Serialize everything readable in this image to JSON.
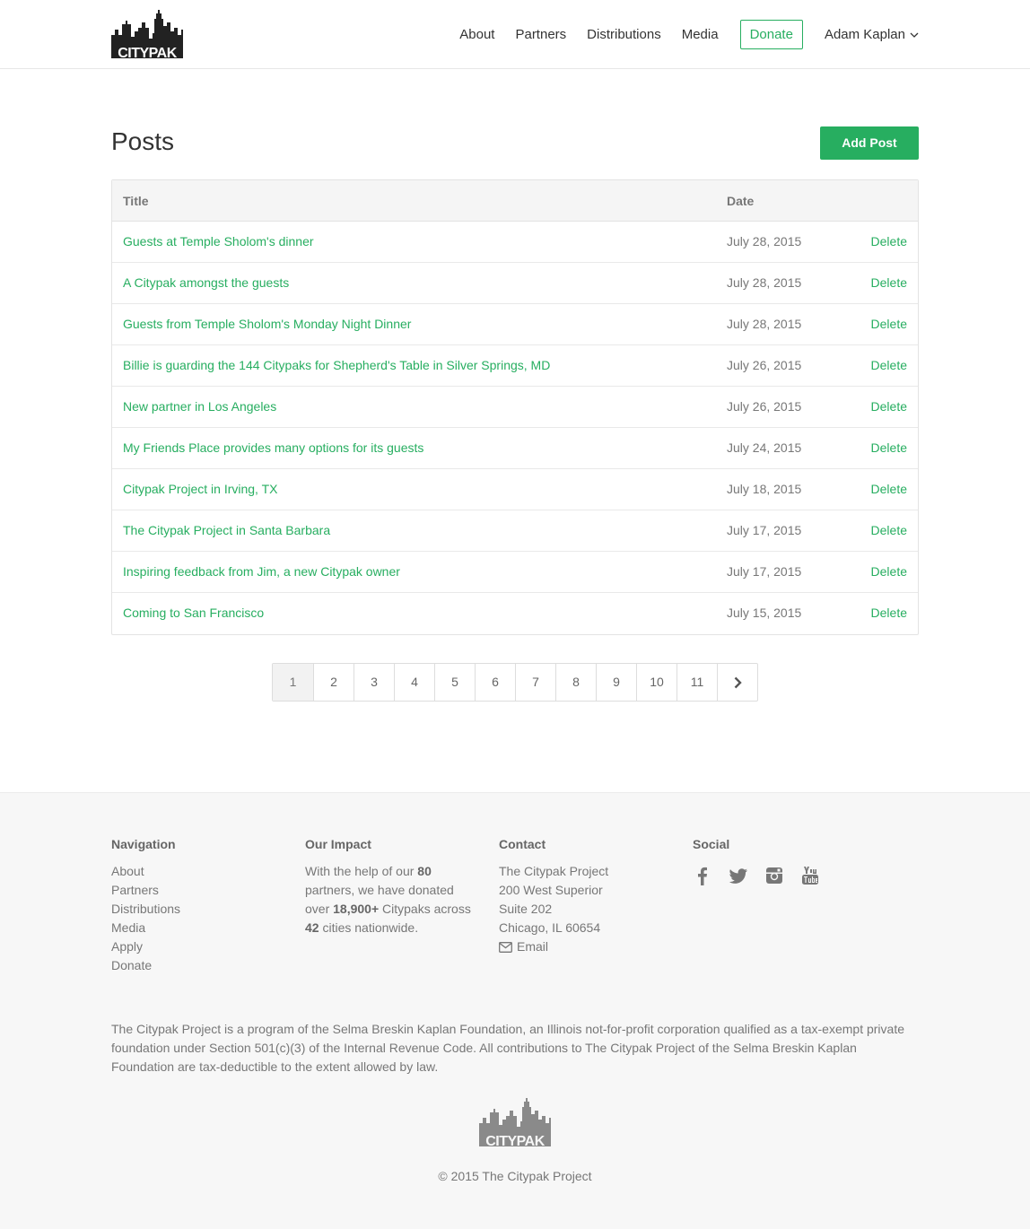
{
  "header": {
    "brand": "CITYPAK",
    "nav": [
      "About",
      "Partners",
      "Distributions",
      "Media"
    ],
    "donate_label": "Donate",
    "user_name": "Adam Kaplan"
  },
  "main": {
    "title": "Posts",
    "add_post_label": "Add Post",
    "table": {
      "col_title": "Title",
      "col_date": "Date",
      "delete_label": "Delete",
      "rows": [
        {
          "title": "Guests at Temple Sholom's dinner",
          "date": "July 28, 2015"
        },
        {
          "title": "A Citypak amongst the guests",
          "date": "July 28, 2015"
        },
        {
          "title": "Guests from Temple Sholom's Monday Night Dinner",
          "date": "July 28, 2015"
        },
        {
          "title": "Billie is guarding the 144 Citypaks for Shepherd's Table in Silver Springs, MD",
          "date": "July 26, 2015"
        },
        {
          "title": "New partner in Los Angeles",
          "date": "July 26, 2015"
        },
        {
          "title": "My Friends Place provides many options for its guests",
          "date": "July 24, 2015"
        },
        {
          "title": "Citypak Project in Irving, TX",
          "date": "July 18, 2015"
        },
        {
          "title": "The Citypak Project in Santa Barbara",
          "date": "July 17, 2015"
        },
        {
          "title": "Inspiring feedback from Jim, a new Citypak owner",
          "date": "July 17, 2015"
        },
        {
          "title": "Coming to San Francisco",
          "date": "July 15, 2015"
        }
      ]
    },
    "pagination": {
      "pages": [
        "1",
        "2",
        "3",
        "4",
        "5",
        "6",
        "7",
        "8",
        "9",
        "10",
        "11"
      ],
      "active": "1",
      "next_icon": "chevron-right-icon"
    }
  },
  "footer": {
    "navigation": {
      "heading": "Navigation",
      "links": [
        "About",
        "Partners",
        "Distributions",
        "Media",
        "Apply",
        "Donate"
      ]
    },
    "impact": {
      "heading": "Our Impact",
      "text_1": "With the help of our ",
      "partners": "80",
      "text_2": " partners, we have donated over ",
      "citypaks": "18,900+",
      "text_3": " Citypaks across ",
      "cities": "42",
      "text_4": " cities nationwide."
    },
    "contact": {
      "heading": "Contact",
      "lines": [
        "The Citypak Project",
        "200 West Superior",
        "Suite 202",
        "Chicago, IL 60654"
      ],
      "email_label": "Email"
    },
    "social": {
      "heading": "Social",
      "icons": [
        "facebook-icon",
        "twitter-icon",
        "instagram-icon",
        "youtube-icon"
      ]
    },
    "legal": "The Citypak Project is a program of the Selma Breskin Kaplan Foundation, an Illinois not-for-profit corporation qualified as a tax-exempt private foundation under Section 501(c)(3) of the Internal Revenue Code. All contributions to The Citypak Project of the Selma Breskin Kaplan Foundation are tax-deductible to the extent allowed by law.",
    "copyright": "© 2015 The Citypak Project"
  },
  "colors": {
    "accent": "#27ae60",
    "logo_dark": "#222222",
    "logo_footer": "#8a8a8a"
  }
}
